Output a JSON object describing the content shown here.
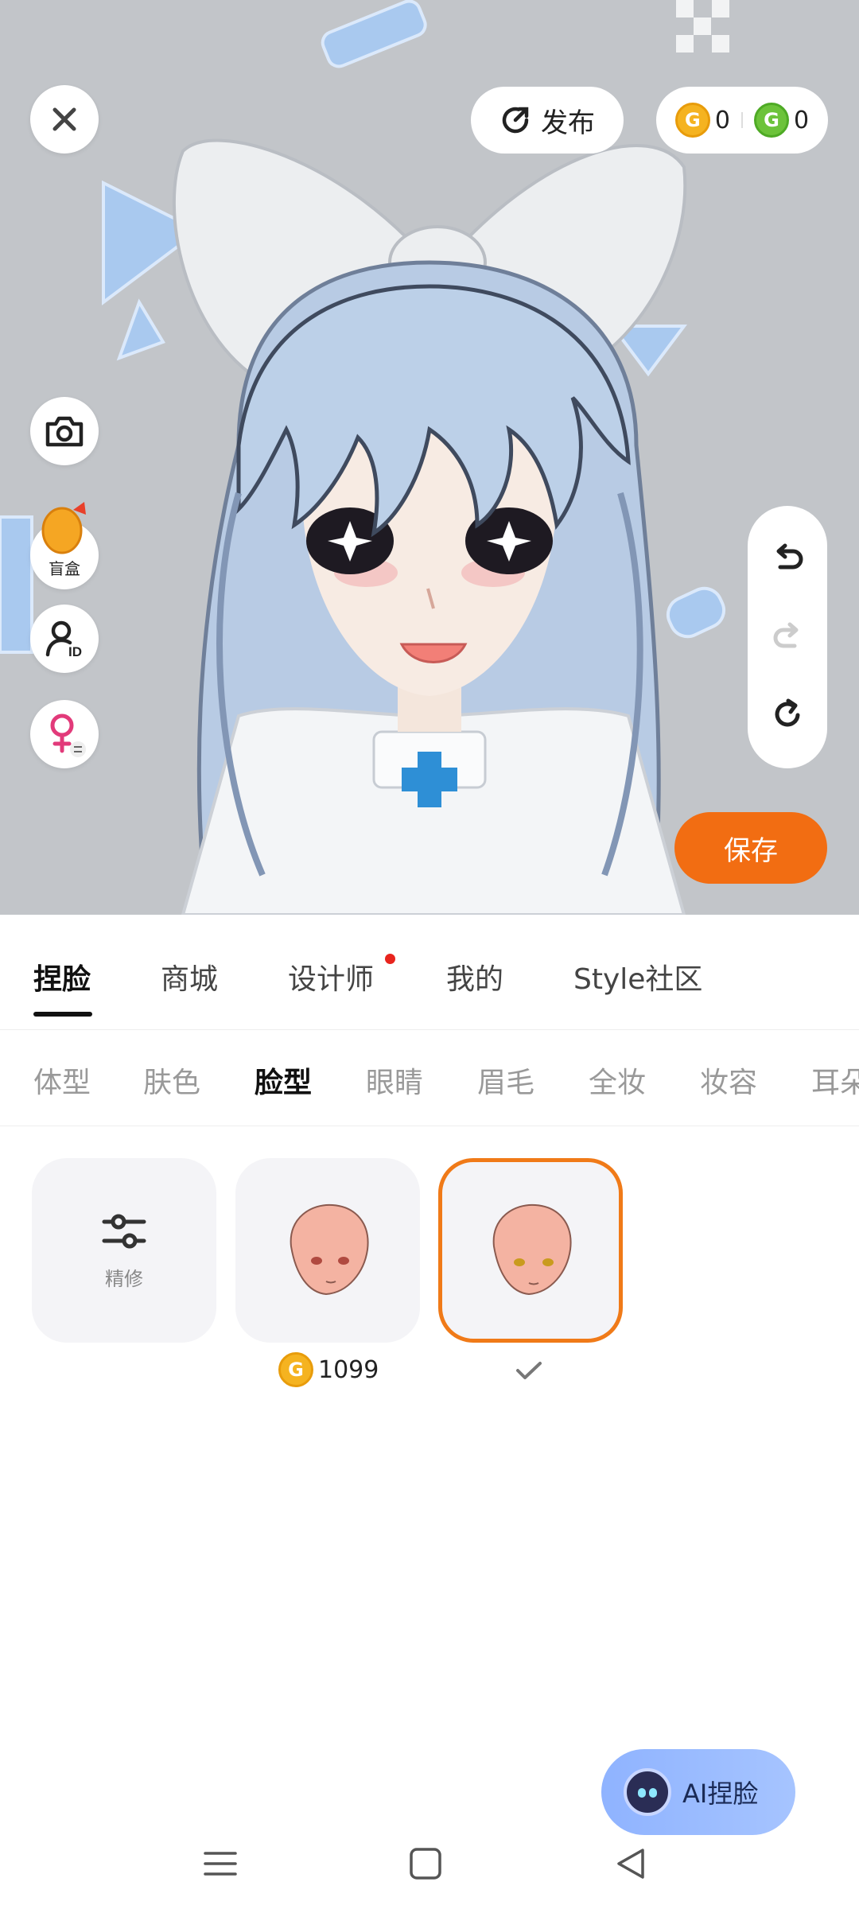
{
  "header": {
    "publish_label": "发布",
    "gold_coin_count": "0",
    "green_coin_count": "0"
  },
  "side_tools": {
    "blind_box_label": "盲盒"
  },
  "actions": {
    "save_label": "保存"
  },
  "main_tabs": [
    {
      "label": "捏脸",
      "active": true
    },
    {
      "label": "商城",
      "active": false
    },
    {
      "label": "设计师",
      "active": false,
      "has_dot": true
    },
    {
      "label": "我的",
      "active": false
    },
    {
      "label": "Style社区",
      "active": false
    }
  ],
  "sub_tabs": [
    {
      "label": "体型",
      "active": false
    },
    {
      "label": "肤色",
      "active": false
    },
    {
      "label": "脸型",
      "active": true
    },
    {
      "label": "眼睛",
      "active": false
    },
    {
      "label": "眉毛",
      "active": false
    },
    {
      "label": "全妆",
      "active": false
    },
    {
      "label": "妆容",
      "active": false
    },
    {
      "label": "耳朵",
      "active": false
    }
  ],
  "items": {
    "refine_label": "精修",
    "item_2_price": "1099",
    "item_3_selected": true
  },
  "ai_button": {
    "label": "AI捏脸"
  },
  "colors": {
    "accent": "#f26d12",
    "selected_border": "#f07a18",
    "notification_dot": "#e8241d",
    "preview_background": "#c2c5c9"
  }
}
